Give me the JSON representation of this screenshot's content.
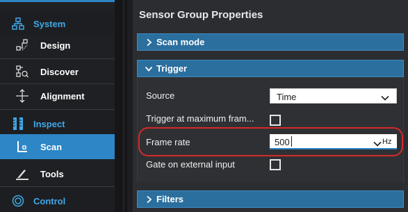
{
  "nav": {
    "sections": [
      {
        "label": "System",
        "icon": "sitemap-icon"
      },
      {
        "label": "Inspect",
        "icon": "ruler-icon"
      },
      {
        "label": "Control",
        "icon": "dial-icon"
      }
    ],
    "items": [
      {
        "label": "Design",
        "icon": "design-icon",
        "active": false
      },
      {
        "label": "Discover",
        "icon": "discover-icon",
        "active": false
      },
      {
        "label": "Alignment",
        "icon": "alignment-icon",
        "active": false
      },
      {
        "label": "Scan",
        "icon": "scan-icon",
        "active": true
      },
      {
        "label": "Tools",
        "icon": "tools-icon",
        "active": false
      }
    ],
    "accent_color": "#2d86c6",
    "section_color": "#3fa9e8"
  },
  "panel": {
    "title": "Sensor Group Properties",
    "sections": [
      {
        "label": "Scan mode",
        "expanded": false
      },
      {
        "label": "Trigger",
        "expanded": true
      },
      {
        "label": "Filters",
        "expanded": false
      }
    ],
    "trigger": {
      "source_label": "Source",
      "source_value": "Time",
      "max_frame_label": "Trigger at maximum fram...",
      "max_frame_checked": false,
      "frame_rate_label": "Frame rate",
      "frame_rate_value": "500",
      "frame_rate_unit": "Hz",
      "gate_label": "Gate on external input",
      "gate_checked": false
    },
    "highlight_color": "#d42a2a"
  }
}
